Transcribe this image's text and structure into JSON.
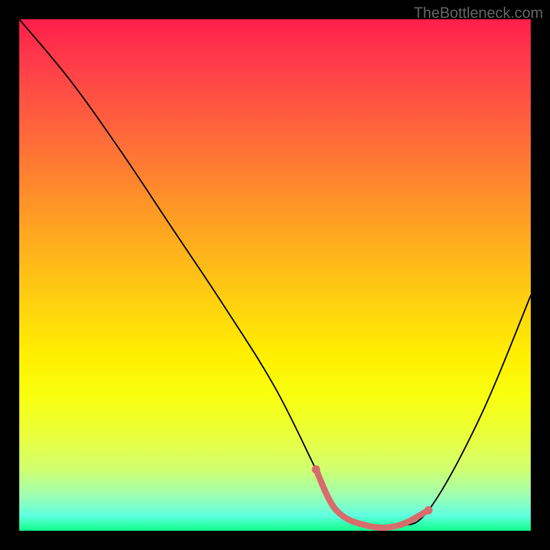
{
  "watermark": "TheBottleneck.com",
  "chart_data": {
    "type": "line",
    "title": "",
    "xlabel": "",
    "ylabel": "",
    "xlim": [
      0,
      100
    ],
    "ylim": [
      0,
      100
    ],
    "series": [
      {
        "name": "bottleneck-curve",
        "x": [
          0,
          10,
          20,
          30,
          40,
          50,
          58,
          62,
          68,
          74,
          80,
          90,
          100
        ],
        "values": [
          100,
          88,
          74,
          59,
          44,
          28,
          12,
          4,
          1,
          1,
          4,
          22,
          46
        ]
      }
    ],
    "optimal_segment": {
      "name": "optimal-range-marker",
      "x": [
        58,
        62,
        68,
        74,
        80
      ],
      "values": [
        12,
        4,
        1,
        1,
        4
      ],
      "color": "#d86b6b"
    }
  }
}
